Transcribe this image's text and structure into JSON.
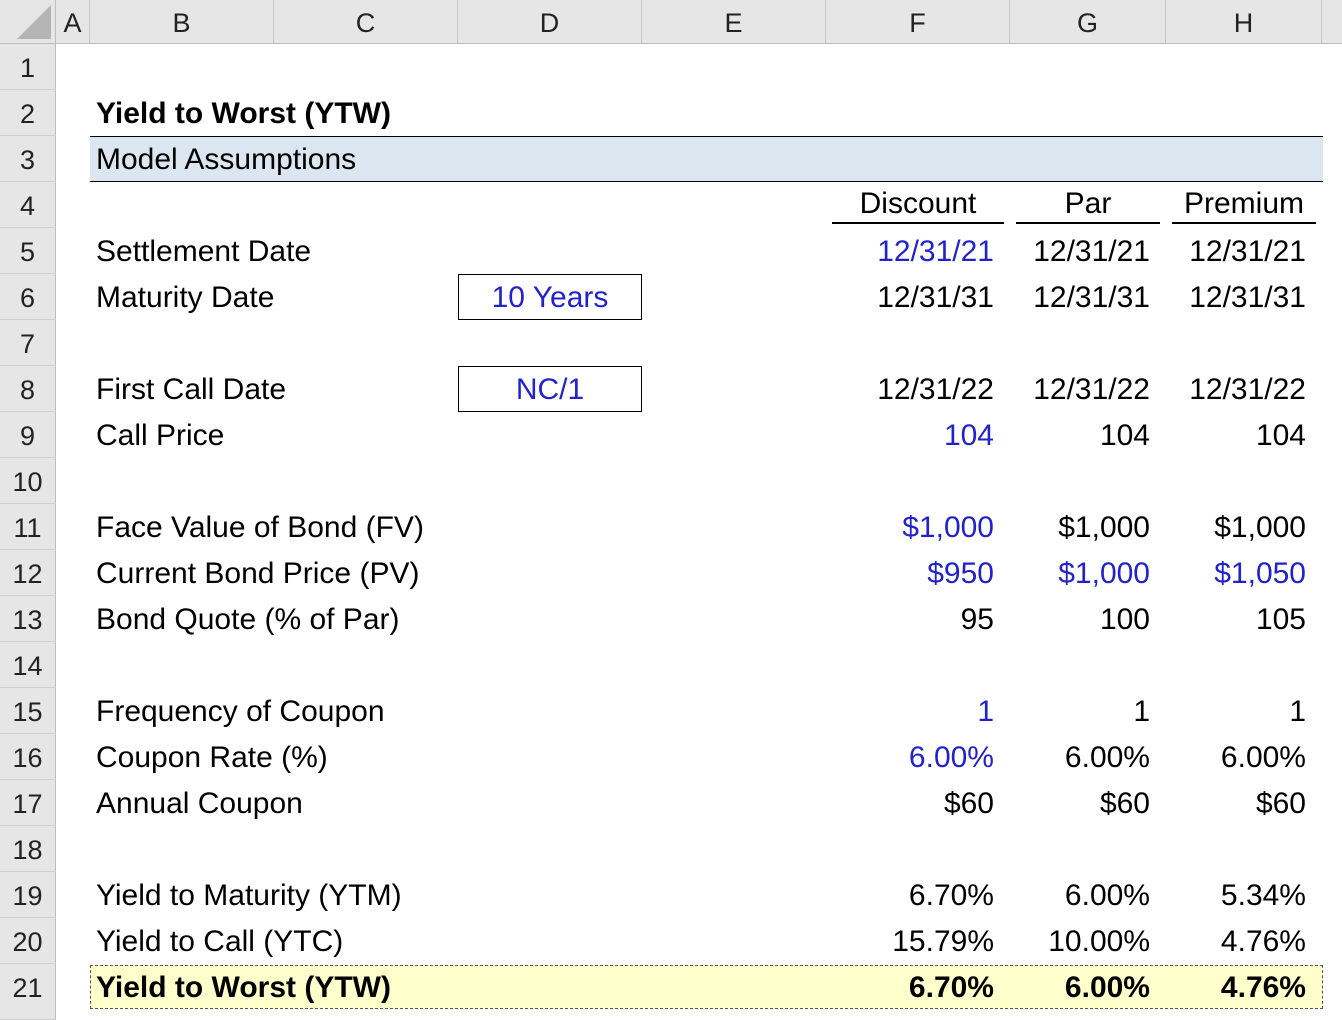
{
  "columns": [
    "A",
    "B",
    "C",
    "D",
    "E",
    "F",
    "G",
    "H"
  ],
  "rows": [
    "1",
    "2",
    "3",
    "4",
    "5",
    "6",
    "7",
    "8",
    "9",
    "10",
    "11",
    "12",
    "13",
    "14",
    "15",
    "16",
    "17",
    "18",
    "19",
    "20",
    "21"
  ],
  "title": "Yield to Worst (YTW)",
  "section": "Model Assumptions",
  "scenarios": [
    "Discount",
    "Par",
    "Premium"
  ],
  "maturity_box": "10 Years",
  "call_box": "NC/1",
  "labels": {
    "settlement": "Settlement Date",
    "maturity": "Maturity Date",
    "first_call": "First Call Date",
    "call_price": "Call Price",
    "face_value": "Face Value of Bond (FV)",
    "bond_price": "Current Bond Price (PV)",
    "bond_quote": "Bond Quote (% of Par)",
    "frequency": "Frequency of Coupon",
    "coupon_rate": "Coupon Rate (%)",
    "annual_coupon": "Annual Coupon",
    "ytm": "Yield to Maturity (YTM)",
    "ytc": "Yield to Call (YTC)",
    "ytw": "Yield to Worst (YTW)"
  },
  "values": {
    "settlement": [
      "12/31/21",
      "12/31/21",
      "12/31/21"
    ],
    "maturity": [
      "12/31/31",
      "12/31/31",
      "12/31/31"
    ],
    "first_call": [
      "12/31/22",
      "12/31/22",
      "12/31/22"
    ],
    "call_price": [
      "104",
      "104",
      "104"
    ],
    "face_value": [
      "$1,000",
      "$1,000",
      "$1,000"
    ],
    "bond_price": [
      "$950",
      "$1,000",
      "$1,050"
    ],
    "bond_quote": [
      "95",
      "100",
      "105"
    ],
    "frequency": [
      "1",
      "1",
      "1"
    ],
    "coupon_rate": [
      "6.00%",
      "6.00%",
      "6.00%"
    ],
    "annual_coupon": [
      "$60",
      "$60",
      "$60"
    ],
    "ytm": [
      "6.70%",
      "6.00%",
      "5.34%"
    ],
    "ytc": [
      "15.79%",
      "10.00%",
      "4.76%"
    ],
    "ytw": [
      "6.70%",
      "6.00%",
      "4.76%"
    ]
  },
  "colors": {
    "input": "#2222cc",
    "section_fill": "#dce6f1",
    "ytw_fill": "#ffffcc"
  }
}
